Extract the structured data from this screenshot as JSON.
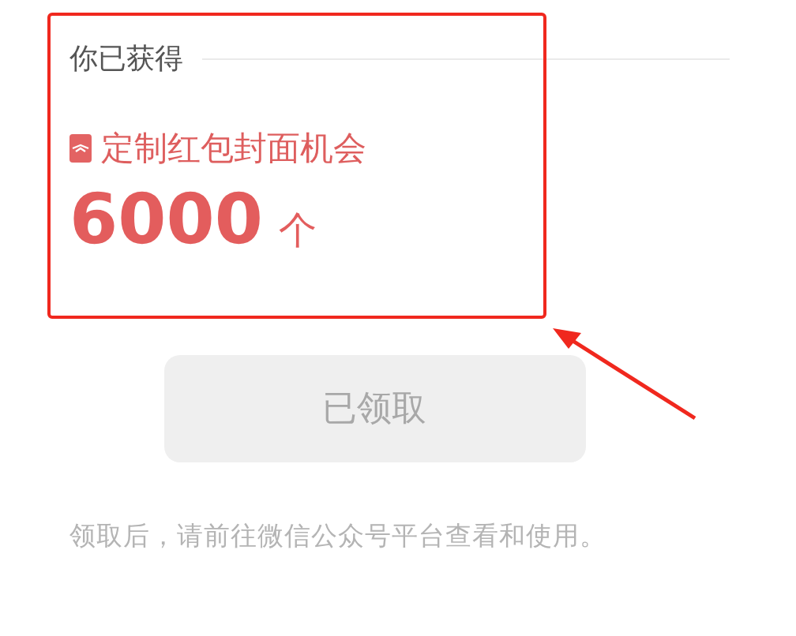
{
  "section_title": "你已获得",
  "reward": {
    "label": "定制红包封面机会",
    "count": "6000",
    "unit": "个"
  },
  "button": {
    "label": "已领取",
    "disabled": true
  },
  "note": "领取后，请前往微信公众号平台查看和使用。"
}
